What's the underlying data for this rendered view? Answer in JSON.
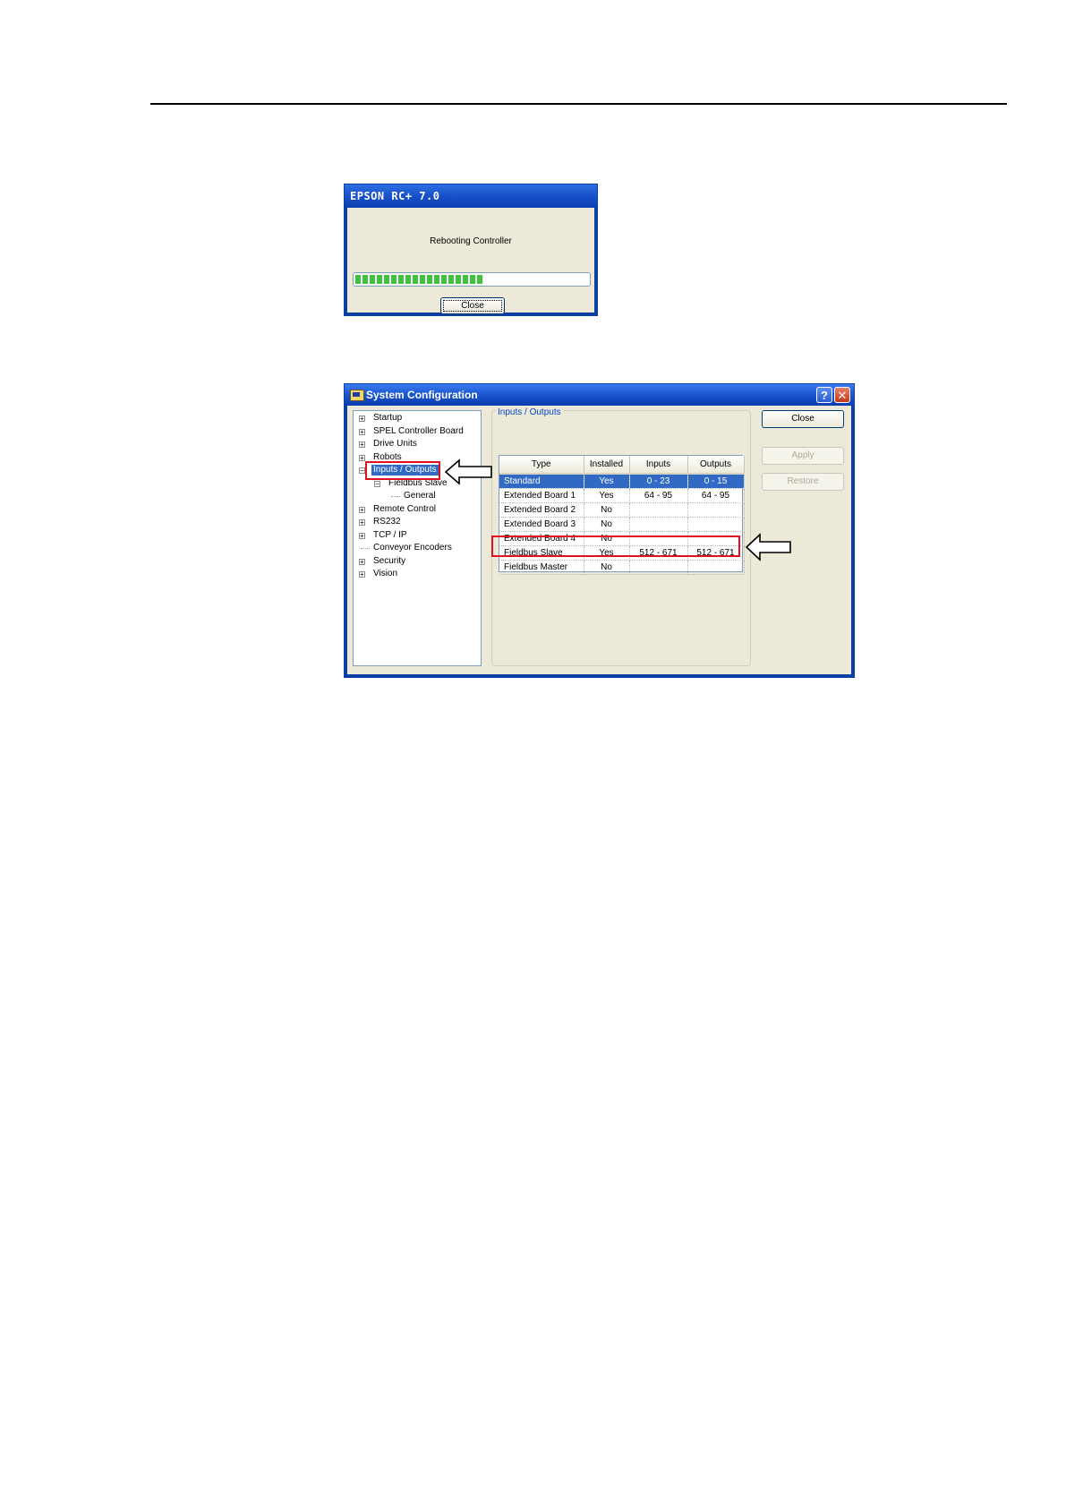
{
  "reboot_dialog": {
    "title": "EPSON RC+ 7.0",
    "message": "Rebooting Controller",
    "progress_fraction": 0.55,
    "close_label": "Close"
  },
  "config_dialog": {
    "title": "System Configuration",
    "help_glyph": "?",
    "close_glyph": "✕",
    "tree": [
      {
        "label": "Startup",
        "expander": "+"
      },
      {
        "label": "SPEL Controller Board",
        "expander": "+"
      },
      {
        "label": "Drive Units",
        "expander": "+"
      },
      {
        "label": "Robots",
        "expander": "+"
      },
      {
        "label": "Inputs / Outputs",
        "expander": "−",
        "selected": true
      },
      {
        "label": "Fieldbus Slave",
        "expander": "−"
      },
      {
        "label": "General",
        "expander": ""
      },
      {
        "label": "Remote Control",
        "expander": "+"
      },
      {
        "label": "RS232",
        "expander": "+"
      },
      {
        "label": "TCP / IP",
        "expander": "+"
      },
      {
        "label": "Conveyor Encoders",
        "expander": ""
      },
      {
        "label": "Security",
        "expander": "+"
      },
      {
        "label": "Vision",
        "expander": "+"
      }
    ],
    "group_label": "Inputs / Outputs",
    "columns": [
      "Type",
      "Installed",
      "Inputs",
      "Outputs"
    ],
    "rows": [
      {
        "type": "Standard",
        "installed": "Yes",
        "inputs": "0 - 23",
        "outputs": "0 - 15"
      },
      {
        "type": "Extended Board 1",
        "installed": "Yes",
        "inputs": "64 - 95",
        "outputs": "64 - 95"
      },
      {
        "type": "Extended Board 2",
        "installed": "No",
        "inputs": "",
        "outputs": ""
      },
      {
        "type": "Extended Board 3",
        "installed": "No",
        "inputs": "",
        "outputs": ""
      },
      {
        "type": "Extended Board 4",
        "installed": "No",
        "inputs": "",
        "outputs": ""
      },
      {
        "type": "Fieldbus Slave",
        "installed": "Yes",
        "inputs": "512 - 671",
        "outputs": "512 - 671"
      },
      {
        "type": "Fieldbus Master",
        "installed": "No",
        "inputs": "",
        "outputs": ""
      }
    ],
    "buttons": {
      "close": "Close",
      "apply": "Apply",
      "restore": "Restore"
    }
  },
  "colors": {
    "highlight": "#e01020",
    "selection": "#316ac5",
    "title_bar": "#1c58d0"
  }
}
